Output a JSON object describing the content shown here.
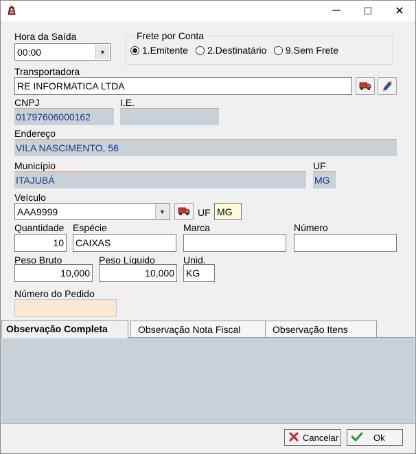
{
  "window": {
    "minimize_glyph": "─",
    "maximize_glyph": "☐",
    "close_glyph": "✕"
  },
  "hora_saida": {
    "label": "Hora da Saída",
    "value": "00:00"
  },
  "frete": {
    "title": "Frete por Conta",
    "options": [
      "1.Emitente",
      "2.Destinatário",
      "9.Sem Frete"
    ],
    "selected": "1.Emitente"
  },
  "transportadora": {
    "label": "Transportadora",
    "value": "RE INFORMATICA LTDA"
  },
  "cnpj": {
    "label": "CNPJ",
    "value": "01797606000162"
  },
  "ie": {
    "label": "I.E.",
    "value": ""
  },
  "endereco": {
    "label": "Endereço",
    "value": "VILA NASCIMENTO, 56"
  },
  "municipio": {
    "label": "Município",
    "value": "ITAJUBÁ"
  },
  "uf_municipio": {
    "label": "UF",
    "value": "MG"
  },
  "veiculo": {
    "label": "Veículo",
    "value": "AAA9999",
    "uf_label": "UF",
    "uf_value": "MG"
  },
  "quantidade": {
    "label": "Quantidade",
    "value": "10"
  },
  "especie": {
    "label": "Espécie",
    "value": "CAIXAS"
  },
  "marca": {
    "label": "Marca",
    "value": ""
  },
  "numero": {
    "label": "Número",
    "value": ""
  },
  "peso_bruto": {
    "label": "Peso Bruto",
    "value": "10,000"
  },
  "peso_liquido": {
    "label": "Peso Líquido",
    "value": "10,000"
  },
  "unid": {
    "label": "Unid.",
    "value": "KG"
  },
  "numero_pedido": {
    "label": "Número do Pedido",
    "value": ""
  },
  "tabs": [
    {
      "label": "Observação Completa",
      "active": true
    },
    {
      "label": "Observação Nota Fiscal",
      "active": false
    },
    {
      "label": "Observação Itens",
      "active": false
    }
  ],
  "buttons": {
    "cancel_label": "Cancelar",
    "ok_label": "Ok"
  },
  "colors": {
    "readonly_bg": "#c8d0d8",
    "readonly_text": "#1a3a8a",
    "accent_underline": "#e8a070",
    "pedido_bg": "#fde9d2",
    "uf_bg": "#fffbd9",
    "cancel_icon": "#d22020",
    "ok_icon": "#1f9a2a"
  },
  "icons": [
    "app-icon",
    "truck-icon",
    "edit-icon",
    "cancel-x-icon",
    "ok-check-icon"
  ]
}
